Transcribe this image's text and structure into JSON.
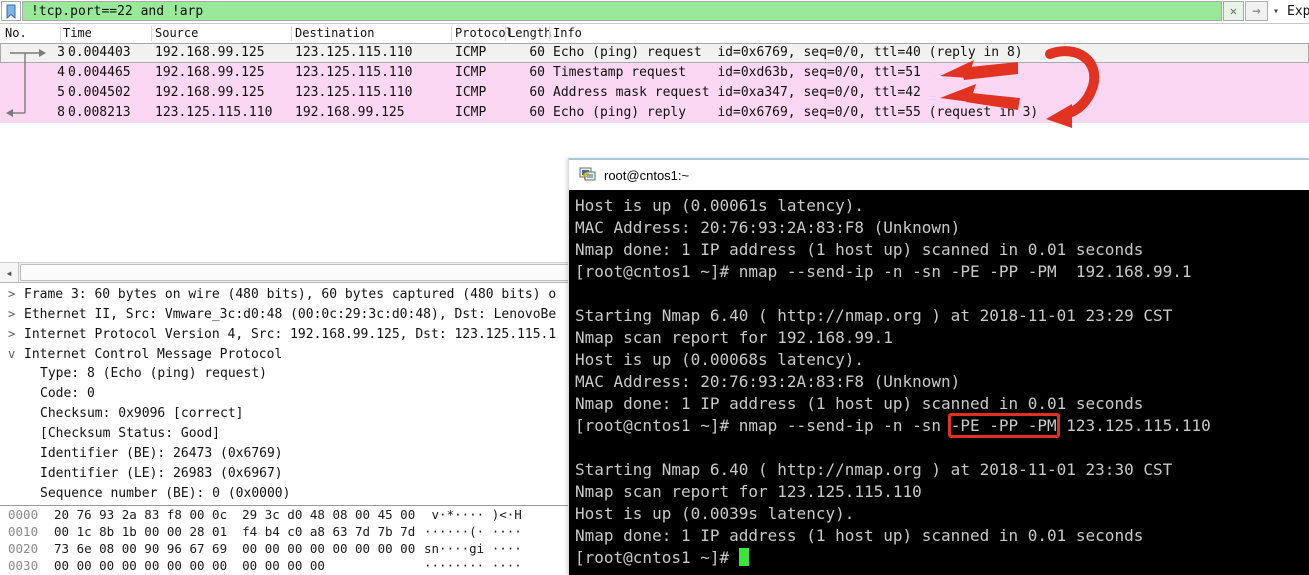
{
  "filter_bar": {
    "filter_text": "!tcp.port==22 and !arp",
    "clear_icon": "✕",
    "apply_icon": "→",
    "dropdown_icon": "▾",
    "expression_label": "Exp",
    "field_bg": "#9ae89a"
  },
  "packet_list": {
    "columns": [
      "No.",
      "Time",
      "Source",
      "Destination",
      "Protocol",
      "Length",
      "Info"
    ],
    "bracket_color": "#7a7a7a",
    "row_pink": "#fbd7f3",
    "row_selected": "#f1f1ef",
    "rows": [
      {
        "no": "3",
        "time": "0.004403",
        "source": "192.168.99.125",
        "destination": "123.125.115.110",
        "protocol": "ICMP",
        "length": "60",
        "info": "Echo (ping) request  id=0x6769, seq=0/0, ttl=40 (reply in 8)",
        "highlight": "selected"
      },
      {
        "no": "4",
        "time": "0.004465",
        "source": "192.168.99.125",
        "destination": "123.125.115.110",
        "protocol": "ICMP",
        "length": "60",
        "info": "Timestamp request    id=0xd63b, seq=0/0, ttl=51",
        "highlight": "pink"
      },
      {
        "no": "5",
        "time": "0.004502",
        "source": "192.168.99.125",
        "destination": "123.125.115.110",
        "protocol": "ICMP",
        "length": "60",
        "info": "Address mask request id=0xa347, seq=0/0, ttl=42",
        "highlight": "pink"
      },
      {
        "no": "8",
        "time": "0.008213",
        "source": "123.125.115.110",
        "destination": "192.168.99.125",
        "protocol": "ICMP",
        "length": "60",
        "info": "Echo (ping) reply    id=0x6769, seq=0/0, ttl=55 (request in 3)",
        "highlight": "pink"
      }
    ]
  },
  "detail_pane": {
    "rows": [
      {
        "expander": ">",
        "indent": 0,
        "text": "Frame 3: 60 bytes on wire (480 bits), 60 bytes captured (480 bits) o"
      },
      {
        "expander": ">",
        "indent": 0,
        "text": "Ethernet II, Src: Vmware_3c:d0:48 (00:0c:29:3c:d0:48), Dst: LenovoBe"
      },
      {
        "expander": ">",
        "indent": 0,
        "text": "Internet Protocol Version 4, Src: 192.168.99.125, Dst: 123.125.115.1"
      },
      {
        "expander": "v",
        "indent": 0,
        "text": "Internet Control Message Protocol"
      },
      {
        "expander": "",
        "indent": 1,
        "text": "Type: 8 (Echo (ping) request)"
      },
      {
        "expander": "",
        "indent": 1,
        "text": "Code: 0"
      },
      {
        "expander": "",
        "indent": 1,
        "text": "Checksum: 0x9096 [correct]"
      },
      {
        "expander": "",
        "indent": 1,
        "text": "[Checksum Status: Good]"
      },
      {
        "expander": "",
        "indent": 1,
        "text": "Identifier (BE): 26473 (0x6769)"
      },
      {
        "expander": "",
        "indent": 1,
        "text": "Identifier (LE): 26983 (0x6967)"
      },
      {
        "expander": "",
        "indent": 1,
        "text": "Sequence number (BE): 0 (0x0000)"
      }
    ]
  },
  "hex_pane": {
    "rows": [
      {
        "offset": "0000",
        "hex": "20 76 93 2a 83 f8 00 0c  29 3c d0 48 08 00 45 00",
        "ascii": " v·*···· )<·H"
      },
      {
        "offset": "0010",
        "hex": "00 1c 8b 1b 00 00 28 01  f4 b4 c0 a8 63 7d 7b 7d",
        "ascii": "······(· ····"
      },
      {
        "offset": "0020",
        "hex": "73 6e 08 00 90 96 67 69  00 00 00 00 00 00 00 00",
        "ascii": "sn····gi ····"
      },
      {
        "offset": "0030",
        "hex": "00 00 00 00 00 00 00 00  00 00 00 00",
        "ascii": "········ ····"
      }
    ]
  },
  "terminal": {
    "title": "root@cntos1:~",
    "bg": "#000000",
    "text_color": "#c9c9c9",
    "cursor_color": "#39e639",
    "highlight_box_color": "#e03020",
    "lines": [
      [
        {
          "t": "Host is up (0.00061s latency)."
        }
      ],
      [
        {
          "t": "MAC Address: 20:76:93:2A:83:F8 (Unknown)"
        }
      ],
      [
        {
          "t": "Nmap done: 1 IP address (1 host up) scanned in 0.01 seconds"
        }
      ],
      [
        {
          "t": "[root@cntos1 ~]# nmap --send-ip -n -sn -PE -PP -PM  192.168.99.1"
        }
      ],
      [
        {
          "t": ""
        }
      ],
      [
        {
          "t": "Starting Nmap 6.40 ( http://nmap.org ) at 2018-11-01 23:29 CST"
        }
      ],
      [
        {
          "t": "Nmap scan report for 192.168.99.1"
        }
      ],
      [
        {
          "t": "Host is up (0.00068s latency)."
        }
      ],
      [
        {
          "t": "MAC Address: 20:76:93:2A:83:F8 (Unknown)"
        }
      ],
      [
        {
          "t": "Nmap done: 1 IP address (1 host up) scanned in 0.01 seconds"
        }
      ],
      [
        {
          "t": "[root@cntos1 ~]# nmap --send-ip -n -sn "
        },
        {
          "t": "-PE -PP -PM",
          "boxed": true
        },
        {
          "t": " 123.125.115.110"
        }
      ],
      [
        {
          "t": ""
        }
      ],
      [
        {
          "t": "Starting Nmap 6.40 ( http://nmap.org ) at 2018-11-01 23:30 CST"
        }
      ],
      [
        {
          "t": "Nmap scan report for 123.125.115.110"
        }
      ],
      [
        {
          "t": "Host is up (0.0039s latency)."
        }
      ],
      [
        {
          "t": "Nmap done: 1 IP address (1 host up) scanned in 0.01 seconds"
        }
      ],
      [
        {
          "t": "[root@cntos1 ~]# ",
          "cursor_after": true
        }
      ]
    ]
  },
  "annotations": {
    "color": "#e23222"
  }
}
